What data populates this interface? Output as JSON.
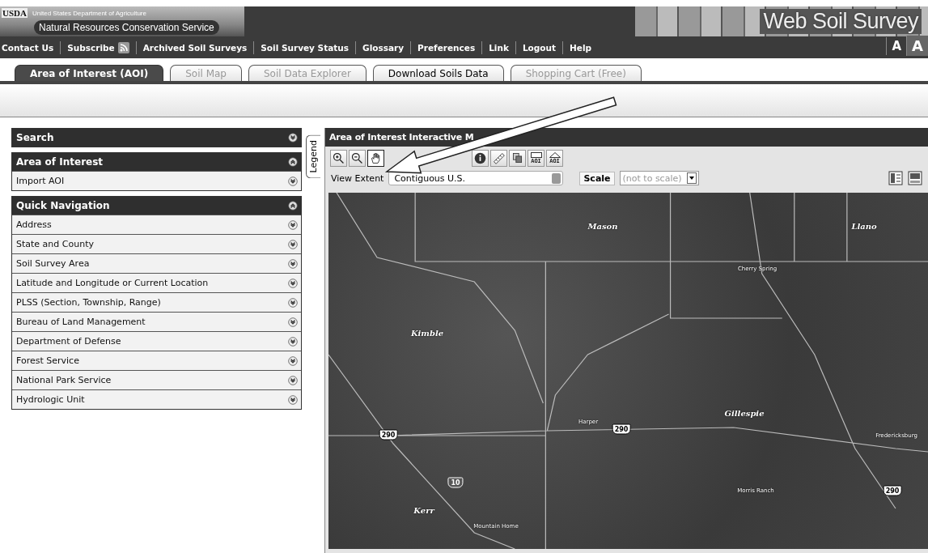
{
  "header": {
    "logo": "USDA",
    "agency": "United States Department of Agriculture",
    "service": "Natural Resources Conservation Service",
    "title": "Web Soil Survey"
  },
  "nav_links": [
    {
      "label": "Contact Us",
      "kind": "link"
    },
    {
      "label": "Subscribe",
      "kind": "rss"
    },
    {
      "label": "Archived Soil Surveys",
      "kind": "link"
    },
    {
      "label": "Soil Survey Status",
      "kind": "link"
    },
    {
      "label": "Glossary",
      "kind": "link"
    },
    {
      "label": "Preferences",
      "kind": "link"
    },
    {
      "label": "Link",
      "kind": "link"
    },
    {
      "label": "Logout",
      "kind": "link"
    },
    {
      "label": "Help",
      "kind": "link"
    }
  ],
  "text_size_buttons": [
    {
      "label": "A",
      "selected": false
    },
    {
      "label": "A",
      "selected": true
    }
  ],
  "tabs": [
    {
      "label": "Area of Interest (AOI)",
      "selected": true,
      "disabled": false
    },
    {
      "label": "Soil Map",
      "selected": false,
      "disabled": true
    },
    {
      "label": "Soil Data Explorer",
      "selected": false,
      "disabled": true
    },
    {
      "label": "Download Soils Data",
      "selected": false,
      "disabled": false
    },
    {
      "label": "Shopping Cart (Free)",
      "selected": false,
      "disabled": true
    }
  ],
  "sidebar": {
    "sections": [
      {
        "title": "Search",
        "expanded": false
      },
      {
        "title": "Area of Interest",
        "expanded": true,
        "items": [
          {
            "label": "Import AOI",
            "expanded": false
          }
        ]
      },
      {
        "title": "Quick Navigation",
        "expanded": true,
        "items": [
          {
            "label": "Address",
            "expanded": false
          },
          {
            "label": "State and County",
            "expanded": false
          },
          {
            "label": "Soil Survey Area",
            "expanded": false
          },
          {
            "label": "Latitude and Longitude or Current Location",
            "expanded": false
          },
          {
            "label": "PLSS (Section, Township, Range)",
            "expanded": false
          },
          {
            "label": "Bureau of Land Management",
            "expanded": false
          },
          {
            "label": "Department of Defense",
            "expanded": false
          },
          {
            "label": "Forest Service",
            "expanded": false
          },
          {
            "label": "National Park Service",
            "expanded": false
          },
          {
            "label": "Hydrologic Unit",
            "expanded": false
          }
        ]
      }
    ]
  },
  "legend_tab": {
    "label": "Legend"
  },
  "map_panel": {
    "title": "Area of Interest Interactive M",
    "tools": [
      {
        "kind": "zoom-in"
      },
      {
        "kind": "zoom-out"
      },
      {
        "kind": "pan",
        "selected": true
      },
      {
        "kind": "info"
      },
      {
        "kind": "ruler"
      },
      {
        "kind": "layers"
      },
      {
        "kind": "aoi-rect",
        "label": "AOI"
      },
      {
        "kind": "aoi-poly",
        "label": "AOI"
      }
    ],
    "view_extent": {
      "label": "View Extent",
      "value": "Contiguous U.S."
    },
    "scale_button": "Scale",
    "scale_select": {
      "value": "(not to scale)",
      "disabled": true
    },
    "map_labels": [
      {
        "label": "Mason",
        "kind": "county"
      },
      {
        "label": "Llano",
        "kind": "county"
      },
      {
        "label": "Cherry Spring",
        "kind": "town"
      },
      {
        "label": "Kimble",
        "kind": "county"
      },
      {
        "label": "Gillespie",
        "kind": "county"
      },
      {
        "label": "Harper",
        "kind": "town"
      },
      {
        "label": "Fredericksburg",
        "kind": "town"
      },
      {
        "label": "Morris Ranch",
        "kind": "town"
      },
      {
        "label": "Kerr",
        "kind": "county"
      },
      {
        "label": "Mountain Home",
        "kind": "town"
      },
      {
        "label": "290",
        "kind": "us-shield"
      },
      {
        "label": "290",
        "kind": "us-shield"
      },
      {
        "label": "290",
        "kind": "us-shield"
      },
      {
        "label": "10",
        "kind": "interstate-shield"
      }
    ]
  }
}
